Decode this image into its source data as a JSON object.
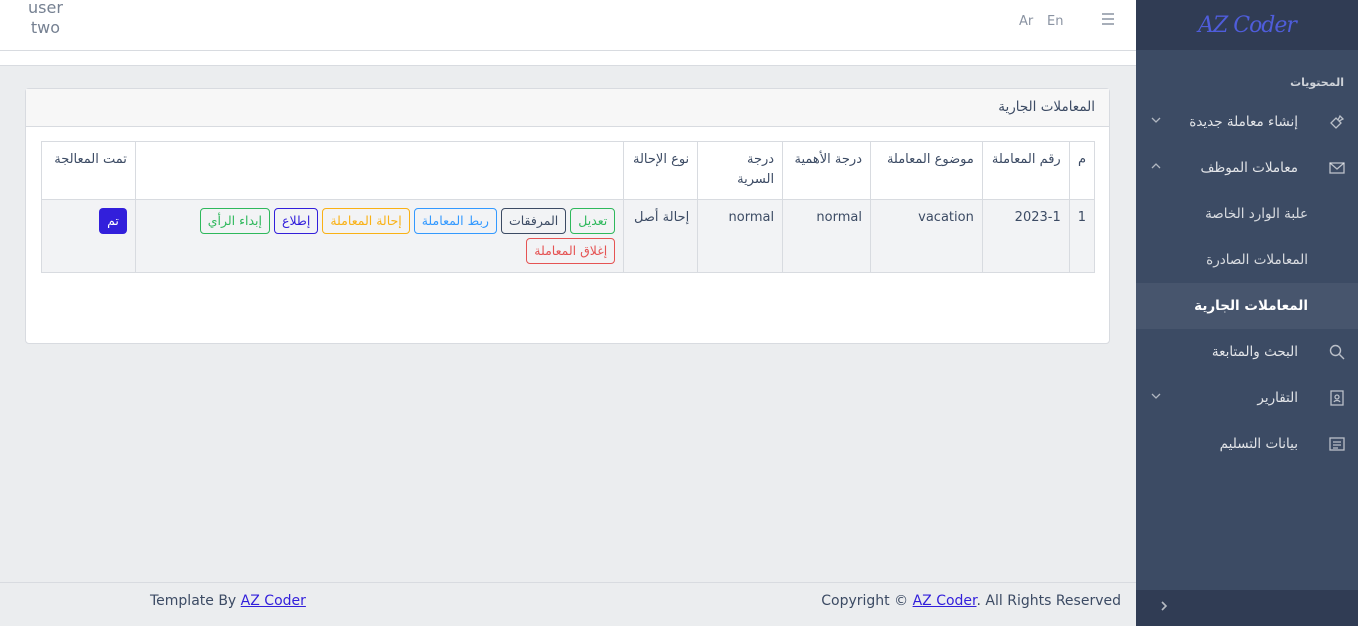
{
  "header": {
    "user_line1": "user",
    "user_line2": "two",
    "lang_en": "En",
    "lang_ar": "Ar"
  },
  "sidebar": {
    "brand": "AZ Coder",
    "section_title": "المحتويات",
    "items": [
      {
        "label": "إنشاء معاملة جديدة"
      },
      {
        "label": "معاملات الموظف"
      },
      {
        "label": "علبة الوارد الخاصة"
      },
      {
        "label": "المعاملات الصادرة"
      },
      {
        "label": "المعاملات الجارية"
      },
      {
        "label": "البحث والمتابعة"
      },
      {
        "label": "التقارير"
      },
      {
        "label": "بيانات التسليم"
      }
    ]
  },
  "card": {
    "title": "المعاملات الجارية"
  },
  "table": {
    "headers": {
      "m": "م",
      "number": "رقم المعاملة",
      "subject": "موضوع المعاملة",
      "importance": "درجة الأهمية",
      "secrecy": "درجة السرية",
      "referral_type": "نوع الإحالة",
      "actions": "",
      "processed": "تمت المعالجة"
    },
    "rows": [
      {
        "m": "1",
        "number": "2023-1",
        "subject": "vacation",
        "importance": "normal",
        "secrecy": "normal",
        "referral_type": "إحالة أصل",
        "actions": {
          "edit": "تعديل",
          "attachments": "المرفقات",
          "link": "ربط المعاملة",
          "refer": "إحالة المعاملة",
          "view": "إطلاع",
          "opinion": "إبداء الرأي",
          "close": "إغلاق المعاملة"
        },
        "processed": "تم"
      }
    ]
  },
  "footer": {
    "template_prefix": "Template By ",
    "template_link": "AZ Coder",
    "copyright_prefix": "Copyright © ",
    "copyright_link": "AZ Coder",
    "copyright_suffix": ". All Rights Reserved"
  }
}
